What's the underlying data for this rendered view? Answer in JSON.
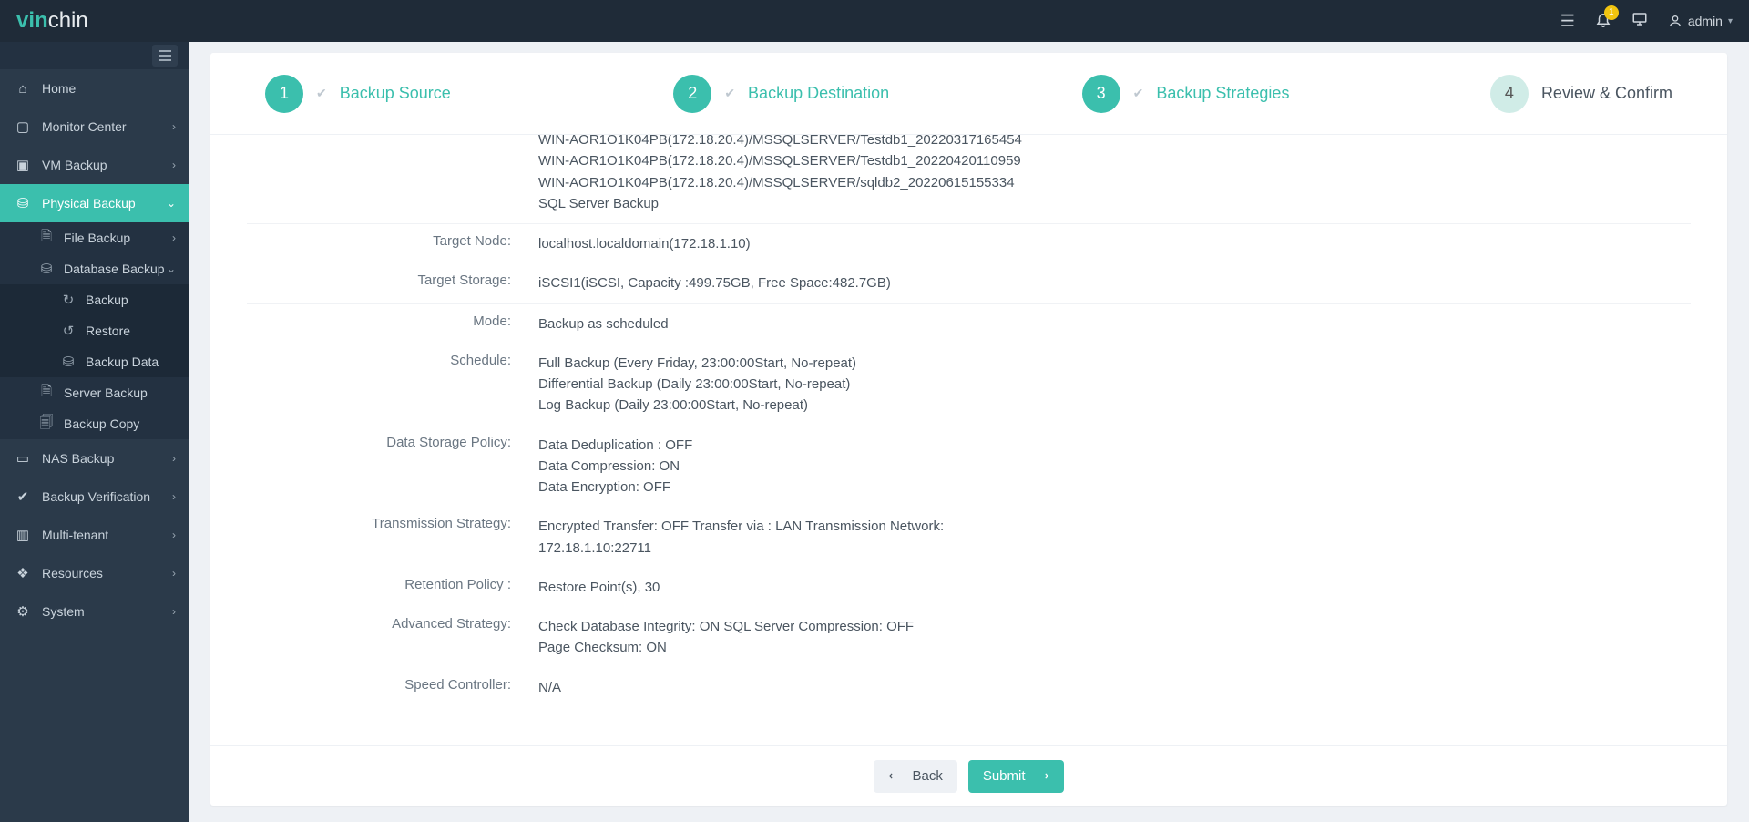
{
  "header": {
    "brand_prefix": "vin",
    "brand_suffix": "chin",
    "notif_count": "1",
    "user": "admin"
  },
  "sidebar": {
    "items": [
      {
        "icon": "⌂",
        "label": "Home"
      },
      {
        "icon": "▢",
        "label": "Monitor Center",
        "expandable": true
      },
      {
        "icon": "▣",
        "label": "VM Backup",
        "expandable": true
      },
      {
        "icon": "⛁",
        "label": "Physical Backup",
        "expandable": true,
        "active": true,
        "children": [
          {
            "icon": "🗎",
            "label": "File Backup",
            "expandable": true
          },
          {
            "icon": "⛁",
            "label": "Database Backup",
            "expandable": true,
            "children": [
              {
                "icon": "↻",
                "label": "Backup"
              },
              {
                "icon": "↺",
                "label": "Restore"
              },
              {
                "icon": "⛁",
                "label": "Backup Data"
              }
            ]
          },
          {
            "icon": "🗎",
            "label": "Server Backup"
          },
          {
            "icon": "🗐",
            "label": "Backup Copy"
          }
        ]
      },
      {
        "icon": "▭",
        "label": "NAS Backup",
        "expandable": true
      },
      {
        "icon": "✔",
        "label": "Backup Verification",
        "expandable": true
      },
      {
        "icon": "▥",
        "label": "Multi-tenant",
        "expandable": true
      },
      {
        "icon": "❖",
        "label": "Resources",
        "expandable": true
      },
      {
        "icon": "⚙",
        "label": "System",
        "expandable": true
      }
    ]
  },
  "steps": {
    "s1": {
      "num": "1",
      "label": "Backup Source"
    },
    "s2": {
      "num": "2",
      "label": "Backup Destination"
    },
    "s3": {
      "num": "3",
      "label": "Backup Strategies"
    },
    "s4": {
      "num": "4",
      "label": "Review & Confirm"
    }
  },
  "review": {
    "source_lines": [
      "WIN-AOR1O1K04PB(172.18.20.4)/MSSQLSERVER/Testdb1_20220317165454",
      "WIN-AOR1O1K04PB(172.18.20.4)/MSSQLSERVER/Testdb1_20220420110959",
      "WIN-AOR1O1K04PB(172.18.20.4)/MSSQLSERVER/sqldb2_20220615155334",
      "SQL Server Backup"
    ],
    "target_node_label": "Target Node:",
    "target_node_value": "localhost.localdomain(172.18.1.10)",
    "target_storage_label": "Target Storage:",
    "target_storage_value": "iSCSI1(iSCSI, Capacity :499.75GB, Free Space:482.7GB)",
    "mode_label": "Mode:",
    "mode_value": "Backup as scheduled",
    "schedule_label": "Schedule:",
    "schedule_lines": [
      "Full Backup (Every Friday, 23:00:00Start, No-repeat)",
      "Differential Backup (Daily 23:00:00Start, No-repeat)",
      "Log Backup (Daily 23:00:00Start, No-repeat)"
    ],
    "data_storage_label": "Data Storage Policy:",
    "data_storage_lines": [
      "Data Deduplication : OFF",
      "Data Compression: ON",
      "Data Encryption: OFF"
    ],
    "transmission_label": "Transmission Strategy:",
    "transmission_lines": [
      "Encrypted Transfer: OFF Transfer via : LAN Transmission Network:",
      "172.18.1.10:22711"
    ],
    "retention_label": "Retention Policy :",
    "retention_value": "Restore Point(s), 30",
    "advanced_label": "Advanced Strategy:",
    "advanced_lines": [
      "Check Database Integrity: ON SQL Server Compression: OFF",
      "Page Checksum: ON"
    ],
    "speed_label": "Speed Controller:",
    "speed_value": "N/A"
  },
  "footer": {
    "back": "Back",
    "submit": "Submit"
  }
}
